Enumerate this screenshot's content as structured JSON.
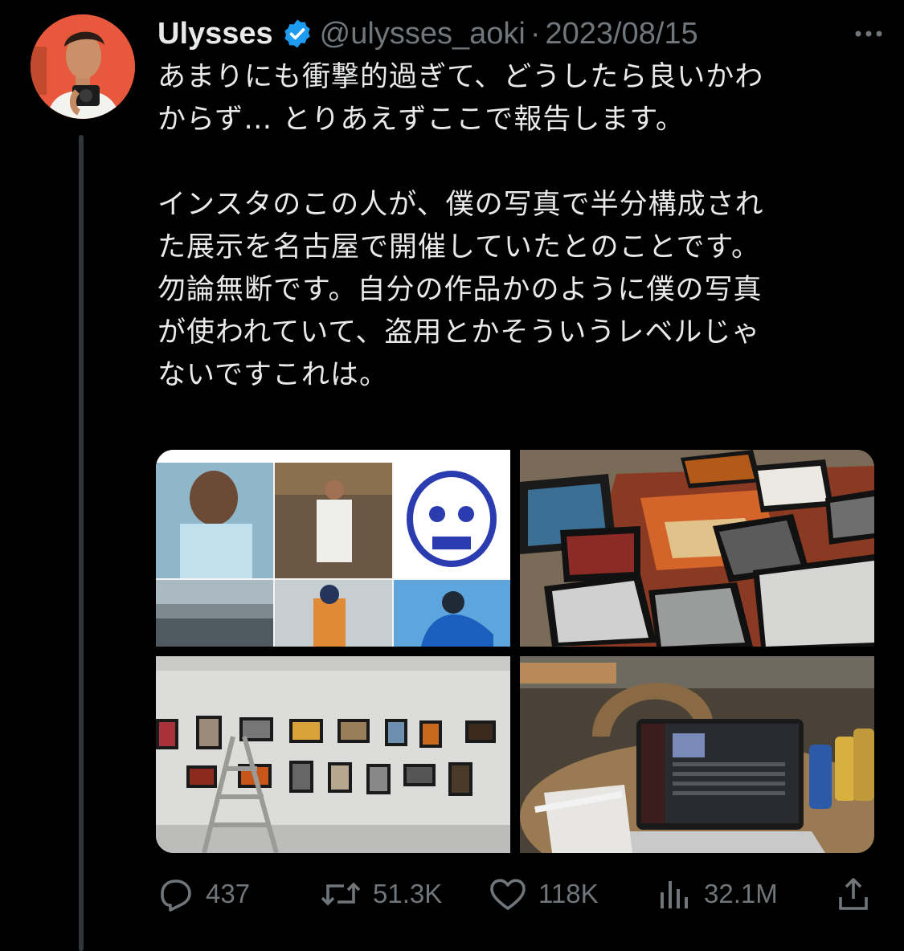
{
  "tweet": {
    "display_name": "Ulysses",
    "handle": "@ulysses_aoki",
    "separator": "·",
    "date": "2023/08/15",
    "text_lines": [
      "あまりにも衝撃的過ぎて、どうしたら良いかわ",
      "からず… とりあえずここで報告します。",
      "",
      "インスタのこの人が、僕の写真で半分構成され",
      "た展示を名古屋で開催していたとのことです。",
      "勿論無断です。自分の作品かのように僕の写真",
      "が使われていて、盗用とかそういうレベルじゃ",
      "ないですこれは。"
    ]
  },
  "actions": {
    "replies": "437",
    "reposts": "51.3K",
    "likes": "118K",
    "views": "32.1M"
  },
  "icons": {
    "verified": "verified-badge-icon",
    "more": "more-icon",
    "reply": "reply-icon",
    "repost": "repost-icon",
    "like": "heart-icon",
    "views": "views-icon",
    "share": "share-icon"
  },
  "colors": {
    "background": "#000000",
    "text": "#e7e9ea",
    "secondary": "#71767b",
    "verified": "#1d9bf0",
    "avatar_bg": "#e8583c"
  }
}
